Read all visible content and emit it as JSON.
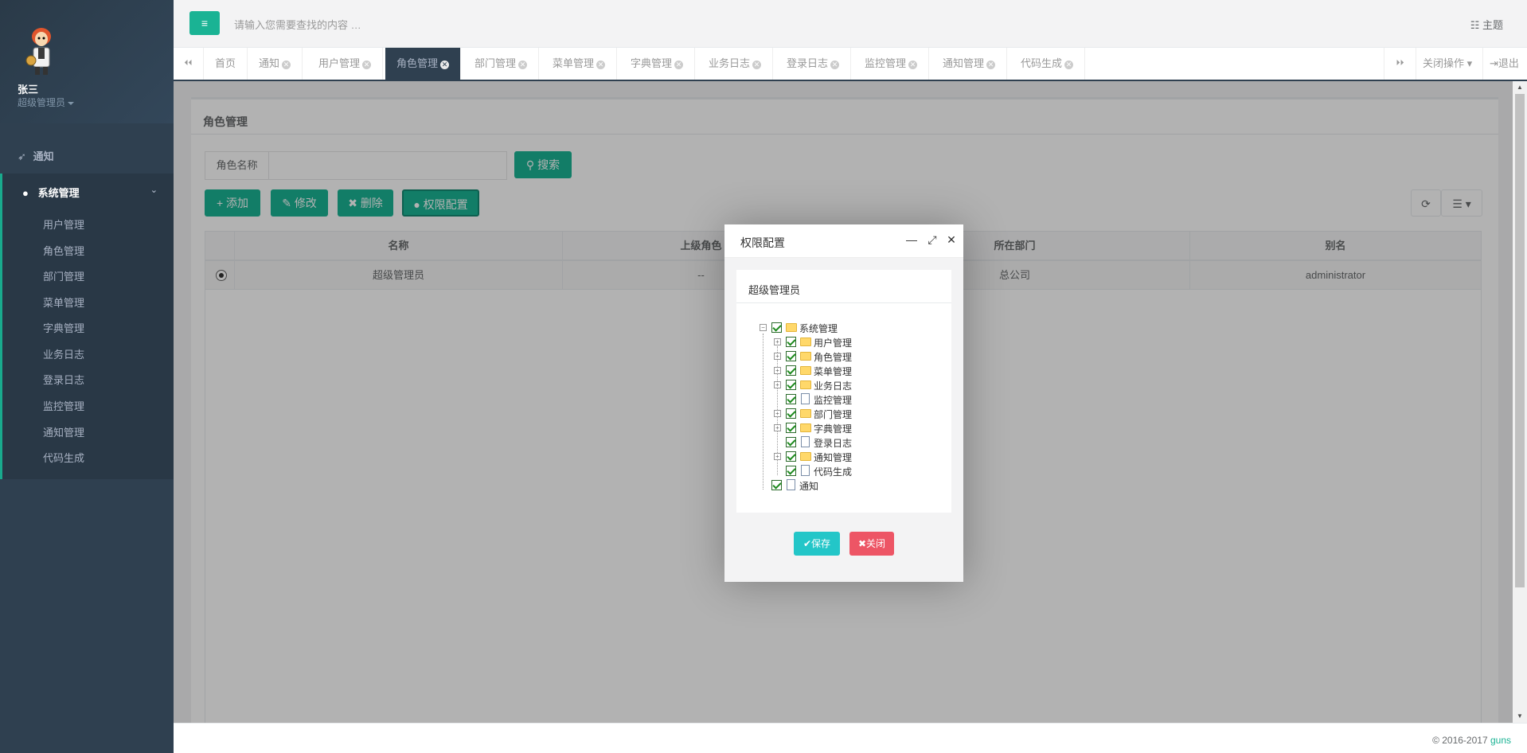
{
  "user": {
    "name": "张三",
    "role": "超级管理员"
  },
  "sidebar": {
    "items": [
      {
        "label": "通知",
        "icon": "rocket-icon"
      },
      {
        "label": "系统管理",
        "icon": "user-icon",
        "arrow": "⌄"
      }
    ],
    "submenu": [
      "用户管理",
      "角色管理",
      "部门管理",
      "菜单管理",
      "字典管理",
      "业务日志",
      "登录日志",
      "监控管理",
      "通知管理",
      "代码生成"
    ]
  },
  "topbar": {
    "menu_icon": "≡",
    "search_placeholder": "请输入您需要查找的内容 …",
    "theme_label": "主题",
    "theme_icon": "☷"
  },
  "tabs": {
    "prev_icon": "⏴⏴",
    "next_icon": "⏵⏵",
    "items": [
      "首页",
      "通知",
      "用户管理",
      "角色管理",
      "部门管理",
      "菜单管理",
      "字典管理",
      "业务日志",
      "登录日志",
      "监控管理",
      "通知管理",
      "代码生成"
    ],
    "active": "角色管理",
    "close_ops": "关闭操作",
    "logout": "退出"
  },
  "panel": {
    "title": "角色管理",
    "search_label": "角色名称",
    "search_btn": "搜索",
    "buttons": {
      "add": "添加",
      "edit": "修改",
      "delete": "删除",
      "perm": "权限配置"
    },
    "table": {
      "headers": [
        "名称",
        "上级角色",
        "所在部门",
        "别名"
      ],
      "rows": [
        {
          "name": "超级管理员",
          "parent": "--",
          "dept": "总公司",
          "alias": "administrator"
        }
      ]
    }
  },
  "modal": {
    "title": "权限配置",
    "subtitle": "超级管理员",
    "tree": {
      "root": "系统管理",
      "children": [
        "用户管理",
        "角色管理",
        "菜单管理",
        "业务日志",
        "监控管理",
        "部门管理",
        "字典管理",
        "登录日志",
        "通知管理",
        "代码生成"
      ],
      "sibling": "通知"
    },
    "save": "保存",
    "close": "关闭"
  },
  "footer": {
    "copyright": "© 2016-2017",
    "link": "guns"
  },
  "colors": {
    "sidebar": "#2f4050",
    "accent": "#1ab394",
    "info": "#23c6c8",
    "danger": "#ed5565"
  }
}
